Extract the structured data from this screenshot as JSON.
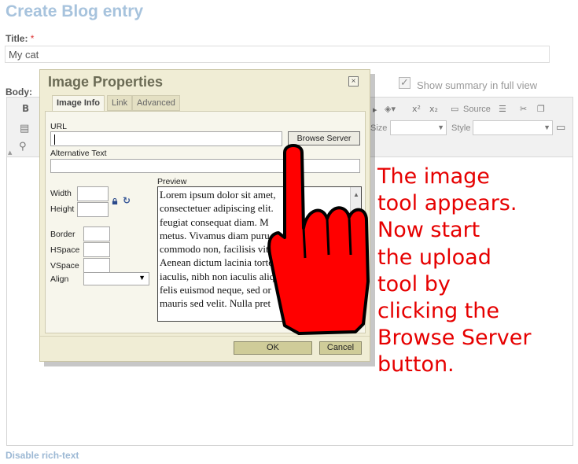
{
  "page": {
    "title": "Create Blog entry",
    "title_field_label": "Title:",
    "required_mark": "*",
    "title_value": "My cat",
    "body_label": "Body:",
    "summary_label": "Show summary in full view",
    "disable_rich_text": "Disable rich-text"
  },
  "toolbar": {
    "source_label": "Source",
    "size_label": "Size",
    "style_label": "Style"
  },
  "dialog": {
    "title": "Image Properties",
    "close_glyph": "×",
    "tabs": [
      {
        "label": "Image Info",
        "active": true
      },
      {
        "label": "Link",
        "active": false
      },
      {
        "label": "Advanced",
        "active": false
      }
    ],
    "url_label": "URL",
    "url_value": "",
    "browse_button": "Browse Server",
    "alt_text_label": "Alternative Text",
    "alt_text_value": "",
    "width_label": "Width",
    "height_label": "Height",
    "border_label": "Border",
    "hspace_label": "HSpace",
    "vspace_label": "VSpace",
    "align_label": "Align",
    "preview_label": "Preview",
    "preview_lines": [
      "Lorem ipsum dolor sit amet,",
      "consectetuer adipiscing elit.",
      "feugiat consequat diam. M",
      "metus. Vivamus diam puru",
      "commodo non, facilisis vita",
      "Aenean dictum lacinia torto",
      "iaculis, nibh non iaculis aliqu",
      "felis euismod neque, sed or",
      "mauris sed velit. Nulla pret"
    ],
    "ok_button": "OK",
    "cancel_button": "Cancel"
  },
  "annotation": {
    "lines": [
      "The image",
      "tool appears.",
      "Now start",
      "the upload",
      "tool by",
      "clicking the",
      "Browse Server",
      "button."
    ],
    "color": "#e60000"
  },
  "colors": {
    "page_title": "#a7c3dd",
    "dialog_bg": "#f0edd5",
    "button_bg": "#cfcc99",
    "hand_fill": "#ff0000"
  },
  "icons": [
    "bold-icon",
    "paste-icon",
    "find-icon",
    "superscript-icon",
    "subscript-icon",
    "source-icon",
    "cut-icon",
    "copy-icon",
    "lock-icon",
    "reset-size-icon",
    "close-icon",
    "pointing-hand-icon"
  ]
}
